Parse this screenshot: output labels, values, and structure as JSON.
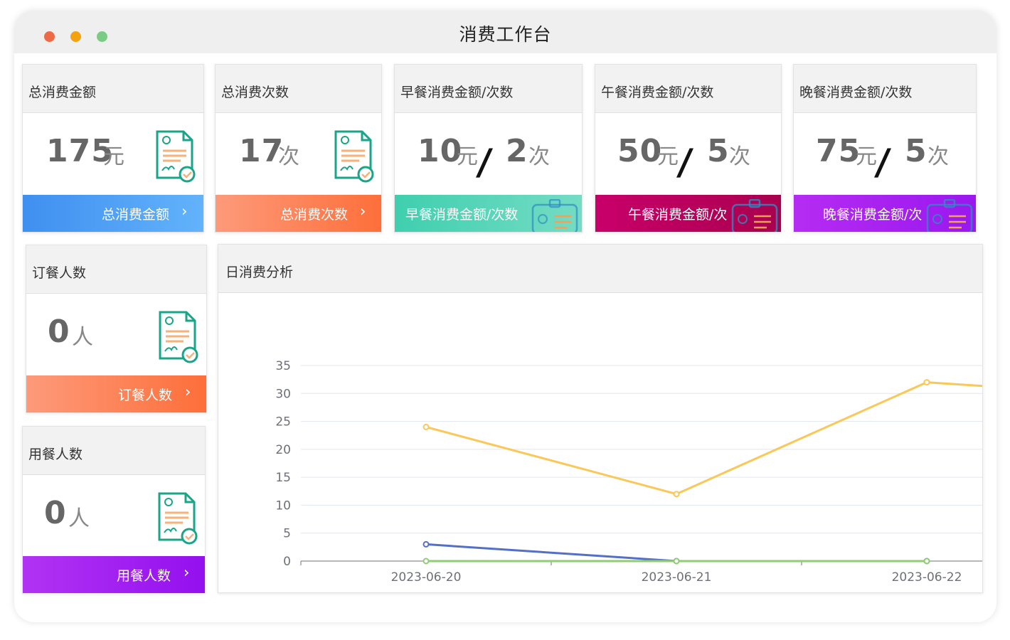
{
  "window": {
    "title": "消费工作台"
  },
  "cards": [
    {
      "title": "总消费金额",
      "value": "175",
      "unit": "元",
      "footer": "总消费金额",
      "chevron": "›"
    },
    {
      "title": "总消费次数",
      "value": "17",
      "unit": "次",
      "footer": "总消费次数",
      "chevron": "›"
    },
    {
      "title": "早餐消费金额/次数",
      "amount": "10",
      "amount_unit": "元",
      "sep": "/",
      "count": "2",
      "count_unit": "次",
      "footer": "早餐消费金额/次数"
    },
    {
      "title": "午餐消费金额/次数",
      "amount": "50",
      "amount_unit": "元",
      "sep": "/",
      "count": "5",
      "count_unit": "次",
      "footer": "午餐消费金额/次"
    },
    {
      "title": "晚餐消费金额/次数",
      "amount": "75",
      "amount_unit": "元",
      "sep": "/",
      "count": "5",
      "count_unit": "次",
      "footer": "晚餐消费金额/次"
    },
    {
      "title": "订餐人数",
      "value": "0",
      "unit": "人",
      "footer": "订餐人数",
      "chevron": "›"
    },
    {
      "title": "用餐人数",
      "value": "0",
      "unit": "人",
      "footer": "用餐人数",
      "chevron": "›"
    }
  ],
  "colors": {
    "blue": "#4aa0f5",
    "orange": "#fd7747",
    "teal": "#4fd1b6",
    "crimson": "#b8005b",
    "purple": "#a326f0",
    "icon_green": "#1aa588"
  },
  "icons": {
    "doc": "certificate-doc-icon",
    "badge": "id-badge-icon",
    "chevron": "chevron-right-icon"
  },
  "chart_panel": {
    "title": "日消费分析"
  },
  "chart_data": {
    "type": "line",
    "categories": [
      "2023-06-20",
      "2023-06-21",
      "2023-06-22"
    ],
    "ylim": [
      0,
      35
    ],
    "yticks": [
      0,
      5,
      10,
      15,
      20,
      25,
      30,
      35
    ],
    "grid": true,
    "series": [
      {
        "values": [
          24,
          12,
          32
        ],
        "color": "#fac858",
        "extends_right_to": 29
      },
      {
        "values": [
          3,
          0,
          0
        ],
        "color": "#5470c6"
      },
      {
        "values": [
          0,
          0,
          0
        ],
        "color": "#91cc75"
      }
    ]
  }
}
